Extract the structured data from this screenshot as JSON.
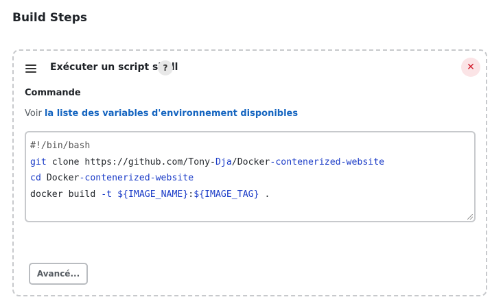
{
  "page": {
    "title": "Build Steps"
  },
  "step": {
    "title": "Exécuter un script shell",
    "help_glyph": "?",
    "close_glyph": "✕",
    "field_label": "Commande",
    "help_prefix": "Voir",
    "help_link": "la liste des variables d'environnement disponibles",
    "code_lines": [
      [
        {
          "t": "#!/bin/bash",
          "c": "c-comment"
        }
      ],
      [
        {
          "t": "git",
          "c": "c-kw"
        },
        {
          "t": " clone https://github.com/Tony-",
          "c": "c-plain"
        },
        {
          "t": "Dja",
          "c": "c-kw"
        },
        {
          "t": "/Docker",
          "c": "c-plain"
        },
        {
          "t": "-contenerized-website",
          "c": "c-kw"
        }
      ],
      [
        {
          "t": "cd",
          "c": "c-kw"
        },
        {
          "t": " Docker",
          "c": "c-plain"
        },
        {
          "t": "-contenerized-website",
          "c": "c-kw"
        }
      ],
      [
        {
          "t": "docker build ",
          "c": "c-plain"
        },
        {
          "t": "-t",
          "c": "c-kw"
        },
        {
          "t": " ",
          "c": "c-plain"
        },
        {
          "t": "${IMAGE_NAME}",
          "c": "c-var"
        },
        {
          "t": ":",
          "c": "c-plain"
        },
        {
          "t": "${IMAGE_TAG}",
          "c": "c-var"
        },
        {
          "t": " .",
          "c": "c-plain"
        }
      ]
    ],
    "advanced_label": "Avancé..."
  },
  "icons": {
    "drag": "drag-handle-icon",
    "help": "help-icon",
    "close": "close-icon"
  },
  "colors": {
    "link": "#1565c0",
    "close": "#d11a2a",
    "close_bg": "#fbe4e6",
    "keyword": "#1a3bc7"
  }
}
